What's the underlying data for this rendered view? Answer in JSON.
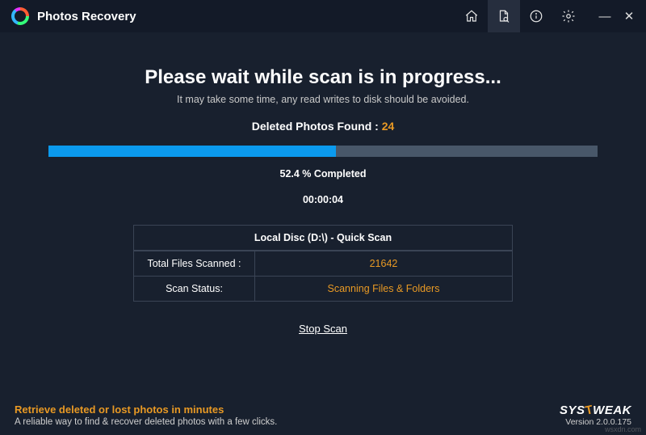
{
  "app_title": "Photos Recovery",
  "nav": {
    "home": "Home",
    "scan": "Scan",
    "info": "About",
    "settings": "Settings"
  },
  "window": {
    "minimize": "—",
    "close": "✕"
  },
  "heading": "Please wait while scan is in progress...",
  "subheading": "It may take some time, any read writes to disk should be avoided.",
  "found_label": "Deleted Photos Found : ",
  "found_count": "24",
  "progress_percent": 52.4,
  "progress_text": "52.4 % Completed",
  "elapsed": "00:00:04",
  "scan_info": {
    "header": "Local Disc (D:\\) - Quick Scan",
    "rows": [
      {
        "key": "Total Files Scanned :",
        "value": "21642"
      },
      {
        "key": "Scan Status:",
        "value": "Scanning Files & Folders"
      }
    ]
  },
  "stop_label": "Stop Scan",
  "footer": {
    "tagline": "Retrieve deleted or lost photos in minutes",
    "desc": "A reliable way to find & recover deleted photos with a few clicks.",
    "brand_name": "SYSTWEAK",
    "version": "Version 2.0.0.175"
  },
  "watermark": "wsxdn.com"
}
